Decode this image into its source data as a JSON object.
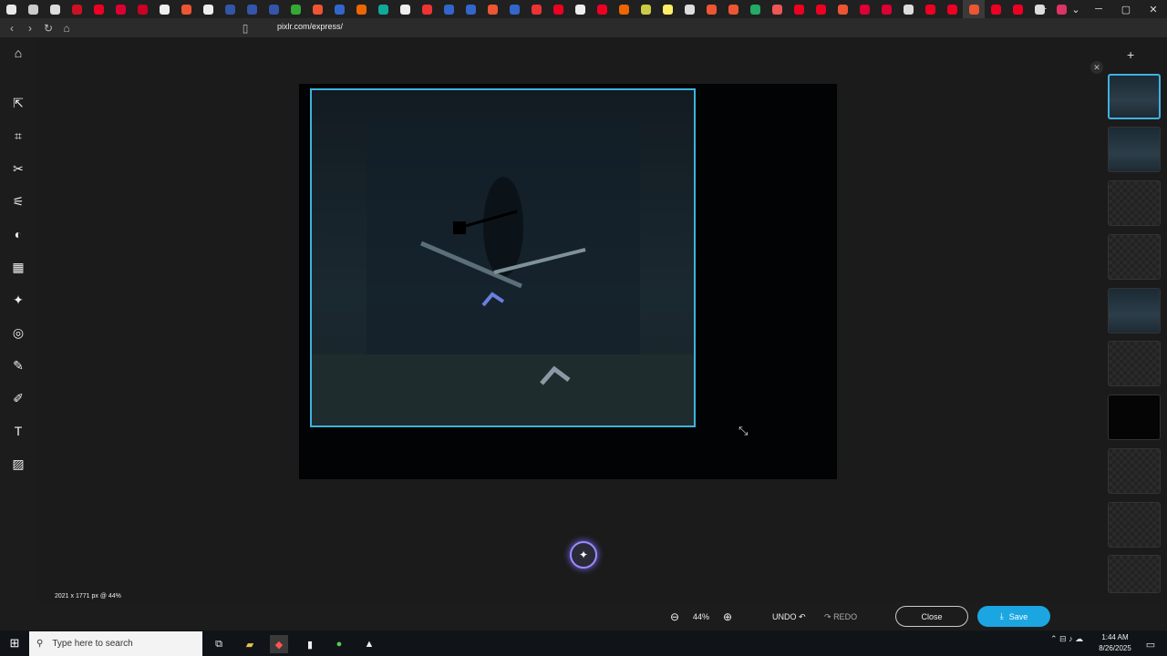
{
  "browser": {
    "url": "pixlr.com/express/",
    "tab_colors": [
      "#e8e8e8",
      "#ccc",
      "#ddd",
      "#c12",
      "#e02",
      "#d03",
      "#c02",
      "#eee",
      "#e53",
      "#eee",
      "#35a",
      "#35a",
      "#35a",
      "#3a3",
      "#e53",
      "#36c",
      "#e60",
      "#1a9",
      "#eee",
      "#e33",
      "#36c",
      "#36c",
      "#e53",
      "#36c",
      "#e33",
      "#e02",
      "#eee",
      "#e02",
      "#e60",
      "#cc4",
      "#fe6",
      "#ddd",
      "#e53",
      "#e53",
      "#2a6",
      "#e55",
      "#e02",
      "#e02",
      "#e53",
      "#d03",
      "#d03",
      "#ddd",
      "#e02",
      "#e02",
      "#e53",
      "#e02",
      "#e02",
      "#ddd",
      "#d36"
    ]
  },
  "left_tools": [
    {
      "name": "home-icon",
      "glyph": "⌂"
    },
    {
      "name": "arrange-icon",
      "glyph": "⇱"
    },
    {
      "name": "crop-icon",
      "glyph": "⌗"
    },
    {
      "name": "cutout-icon",
      "glyph": "✂"
    },
    {
      "name": "adjust-icon",
      "glyph": "⚟"
    },
    {
      "name": "filter-icon",
      "glyph": "◐"
    },
    {
      "name": "effect-icon",
      "glyph": "▦"
    },
    {
      "name": "retouch-icon",
      "glyph": "✦"
    },
    {
      "name": "liquify-icon",
      "glyph": "◎"
    },
    {
      "name": "heal-icon",
      "glyph": "✎"
    },
    {
      "name": "brush-icon",
      "glyph": "✐"
    },
    {
      "name": "text-icon",
      "glyph": "T"
    },
    {
      "name": "pattern-icon",
      "glyph": "▨"
    }
  ],
  "canvas": {
    "size_info": "2021 x 1771 px @ 44%"
  },
  "bottom": {
    "zoom": "44%",
    "undo": "UNDO",
    "redo": "REDO",
    "close": "Close",
    "save": "Save"
  },
  "taskbar": {
    "search_placeholder": "Type here to search",
    "time": "1:44 AM",
    "date": "8/26/2025"
  }
}
